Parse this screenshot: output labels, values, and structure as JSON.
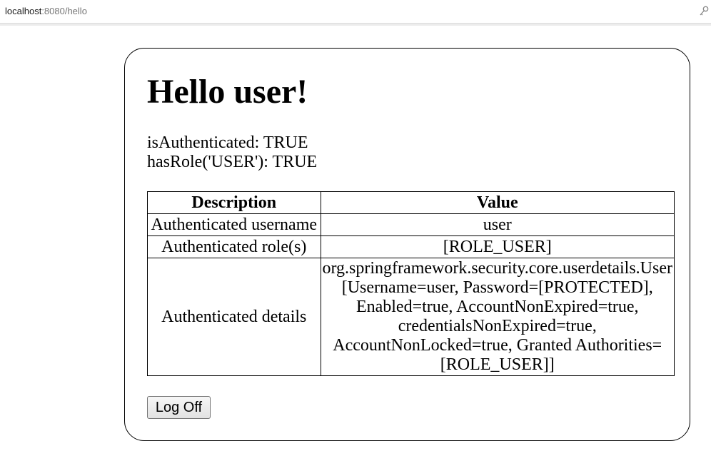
{
  "browser": {
    "url_host": "localhost",
    "url_rest": ":8080/hello"
  },
  "page": {
    "heading": "Hello user!",
    "is_authenticated": "isAuthenticated: TRUE",
    "has_role": "hasRole('USER'): TRUE",
    "logoff_label": "Log Off"
  },
  "table": {
    "headers": [
      "Description",
      "Value"
    ],
    "rows": [
      {
        "description": "Authenticated username",
        "value": "user"
      },
      {
        "description": "Authenticated role(s)",
        "value": "[ROLE_USER]"
      },
      {
        "description": "Authenticated details",
        "value": "org.springframework.security.core.userdetails.User [Username=user, Password=[PROTECTED], Enabled=true, AccountNonExpired=true, credentialsNonExpired=true, AccountNonLocked=true, Granted Authorities=[ROLE_USER]]"
      }
    ]
  }
}
